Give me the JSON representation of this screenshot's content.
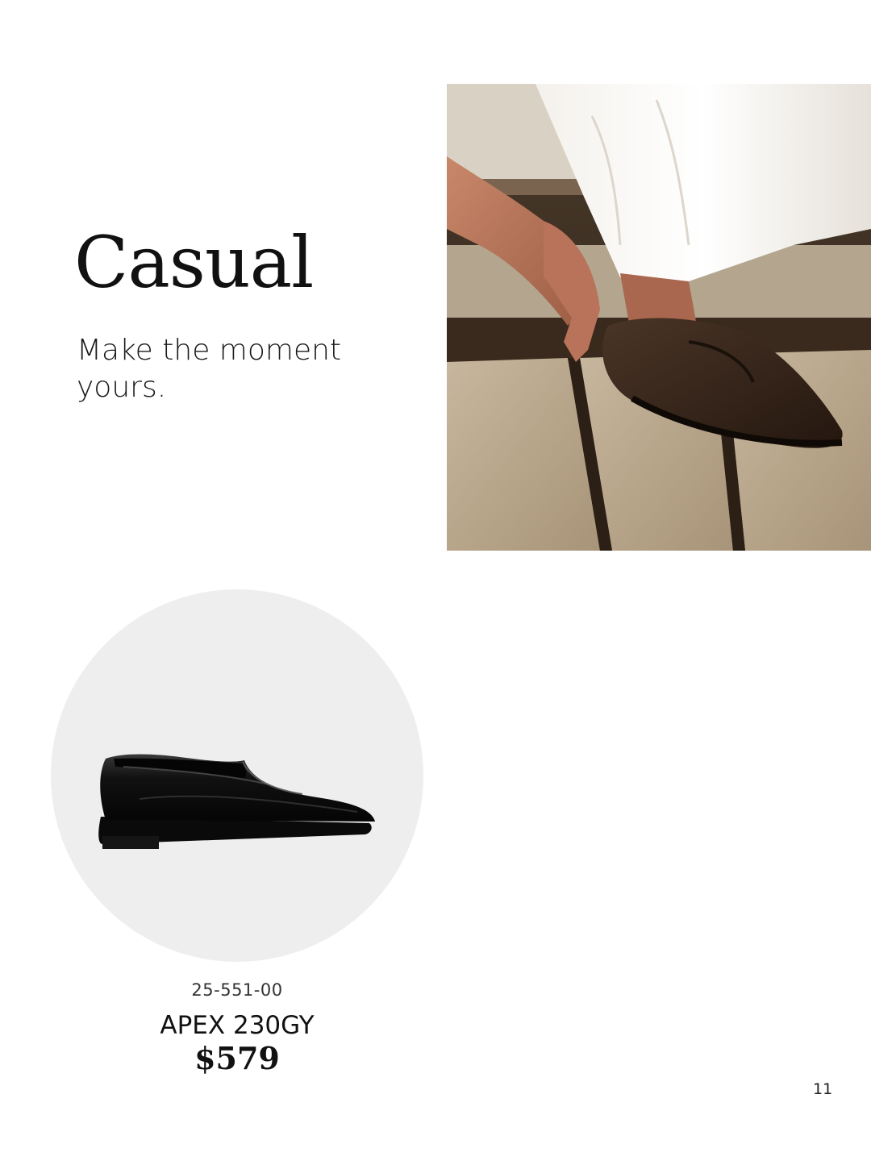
{
  "page": {
    "heading": "Casual",
    "tagline": "Make the moment yours.",
    "page_number": "11"
  },
  "product": {
    "sku": "25-551-00",
    "name": "APEX 230GY",
    "price": "$579",
    "image_icon": "black-loafer-shoe"
  },
  "lifestyle_image": {
    "icon": "man-putting-on-suede-loafer-photo"
  },
  "colors": {
    "background": "#ffffff",
    "circle": "#efeeee",
    "text": "#111111"
  }
}
